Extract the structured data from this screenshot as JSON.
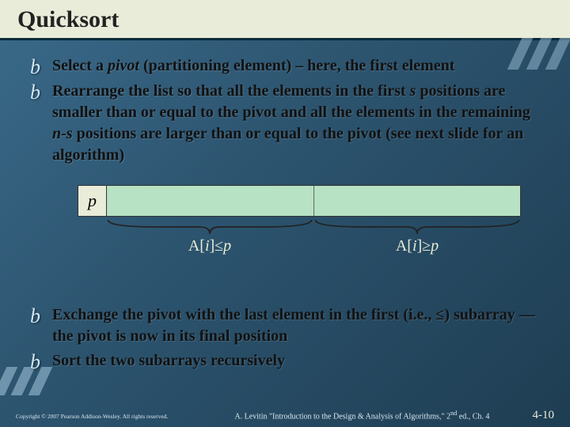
{
  "title": "Quicksort",
  "bullets_top": [
    {
      "html": "Select a <em>pivot</em> (partitioning element) – here, the first element"
    },
    {
      "html": "Rearrange the list so that all the elements in the first <em>s</em> positions are smaller than or equal to the pivot and all the elements in the remaining <em>n-s</em> positions are larger than or equal to the pivot (see next slide for an algorithm)"
    }
  ],
  "diagram": {
    "pivot_label": "p",
    "left_label_html": "A[<em>i</em>]≤<em>p</em>",
    "right_label_html": "A[<em>i</em>]≥<em>p</em>"
  },
  "bullets_bottom": [
    {
      "html": "Exchange the pivot with the last element in the first (i.e., ≤) subarray — the pivot is now in its final position"
    },
    {
      "html": "Sort the two subarrays recursively"
    }
  ],
  "footer": {
    "copyright": "Copyright © 2007 Pearson Addison-Wesley. All rights reserved.",
    "source_html": "A. Levitin \"Introduction to the Design & Analysis of Algorithms,\" 2<sup>nd</sup> ed., Ch. 4",
    "page": "4-10"
  }
}
